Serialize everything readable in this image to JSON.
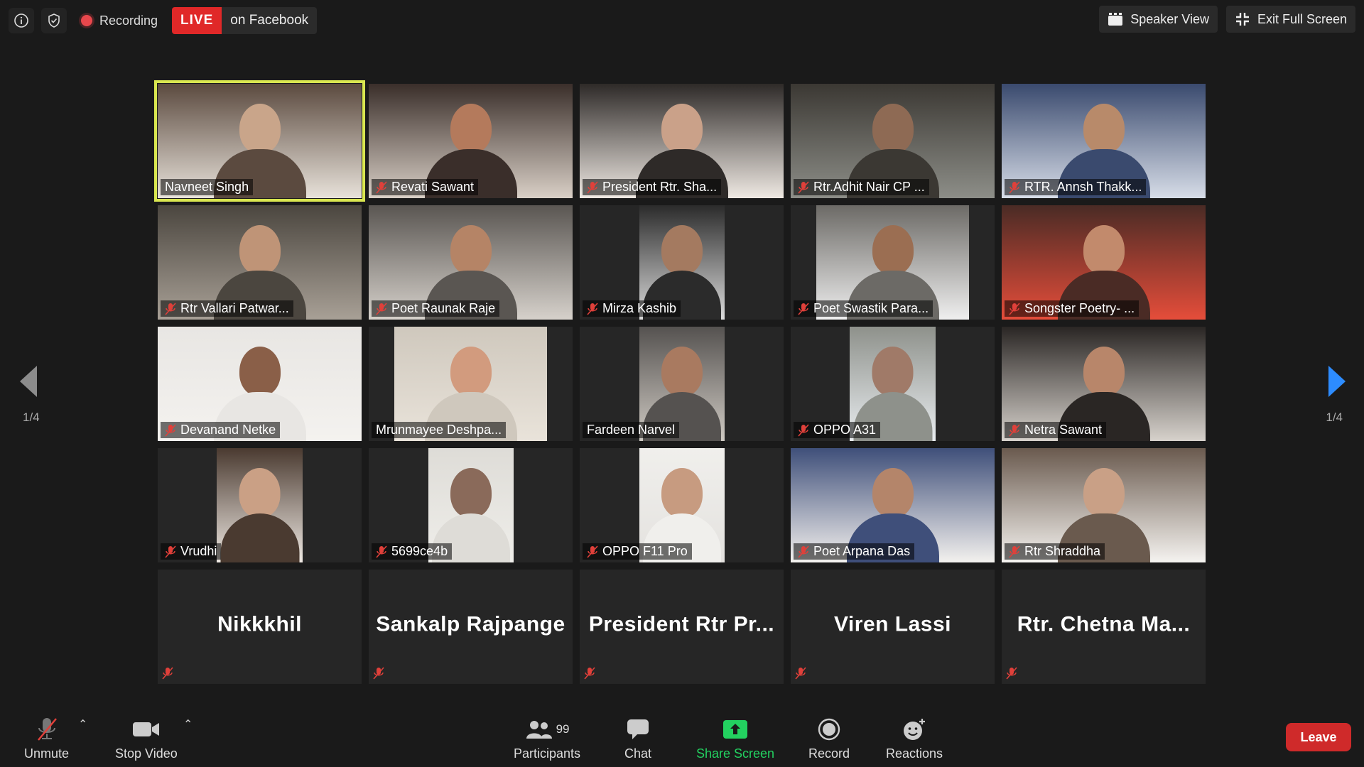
{
  "top_bar": {
    "recording_label": "Recording",
    "live_label": "LIVE",
    "live_destination": "on Facebook",
    "speaker_view_label": "Speaker View",
    "exit_full_screen_label": "Exit Full Screen"
  },
  "pagination": {
    "left": "1/4",
    "right": "1/4"
  },
  "participants_grid": [
    {
      "name": "Navneet Singh",
      "muted": false,
      "active": true,
      "video": "full"
    },
    {
      "name": "Revati Sawant",
      "muted": true,
      "video": "full"
    },
    {
      "name": "President Rtr. Sha...",
      "muted": true,
      "video": "full"
    },
    {
      "name": "Rtr.Adhit Nair CP ...",
      "muted": true,
      "video": "full"
    },
    {
      "name": "RTR. Annsh Thakk...",
      "muted": true,
      "video": "full"
    },
    {
      "name": "Rtr Vallari Patwar...",
      "muted": true,
      "video": "full"
    },
    {
      "name": "Poet Raunak Raje",
      "muted": true,
      "video": "full"
    },
    {
      "name": "Mirza Kashib",
      "muted": true,
      "video": "narrow"
    },
    {
      "name": "Poet Swastik Para...",
      "muted": true,
      "video": "mid"
    },
    {
      "name": "Songster Poetry- ...",
      "muted": true,
      "video": "full"
    },
    {
      "name": "Devanand Netke",
      "muted": true,
      "video": "full"
    },
    {
      "name": "Mrunmayee Deshpa...",
      "muted": false,
      "video": "mid"
    },
    {
      "name": "Fardeen Narvel",
      "muted": false,
      "video": "narrow"
    },
    {
      "name": "OPPO A31",
      "muted": true,
      "video": "slim"
    },
    {
      "name": "Netra Sawant",
      "muted": true,
      "video": "full"
    },
    {
      "name": "Vrudhi",
      "muted": true,
      "video": "slim"
    },
    {
      "name": "5699ce4b",
      "muted": true,
      "video": "narrow"
    },
    {
      "name": "OPPO F11 Pro",
      "muted": true,
      "video": "narrow"
    },
    {
      "name": "Poet Arpana Das",
      "muted": true,
      "video": "full"
    },
    {
      "name": "Rtr Shraddha",
      "muted": true,
      "video": "full"
    }
  ],
  "participants_text_only": [
    {
      "name": "Nikkkhil"
    },
    {
      "name": "Sankalp Rajpange"
    },
    {
      "name": "President Rtr Pr..."
    },
    {
      "name": "Viren Lassi"
    },
    {
      "name": "Rtr. Chetna Ma..."
    }
  ],
  "toolbar": {
    "unmute": "Unmute",
    "stop_video": "Stop Video",
    "participants": "Participants",
    "participants_count": "99",
    "chat": "Chat",
    "share_screen": "Share Screen",
    "record": "Record",
    "reactions": "Reactions",
    "leave": "Leave"
  },
  "colors": {
    "background": "#1a1a1a",
    "active_speaker_border": "#d9e650",
    "live_red": "#e02828",
    "share_green": "#23d160",
    "nav_arrow_blue": "#2d8cff",
    "leave_red": "#cf2a2a"
  }
}
